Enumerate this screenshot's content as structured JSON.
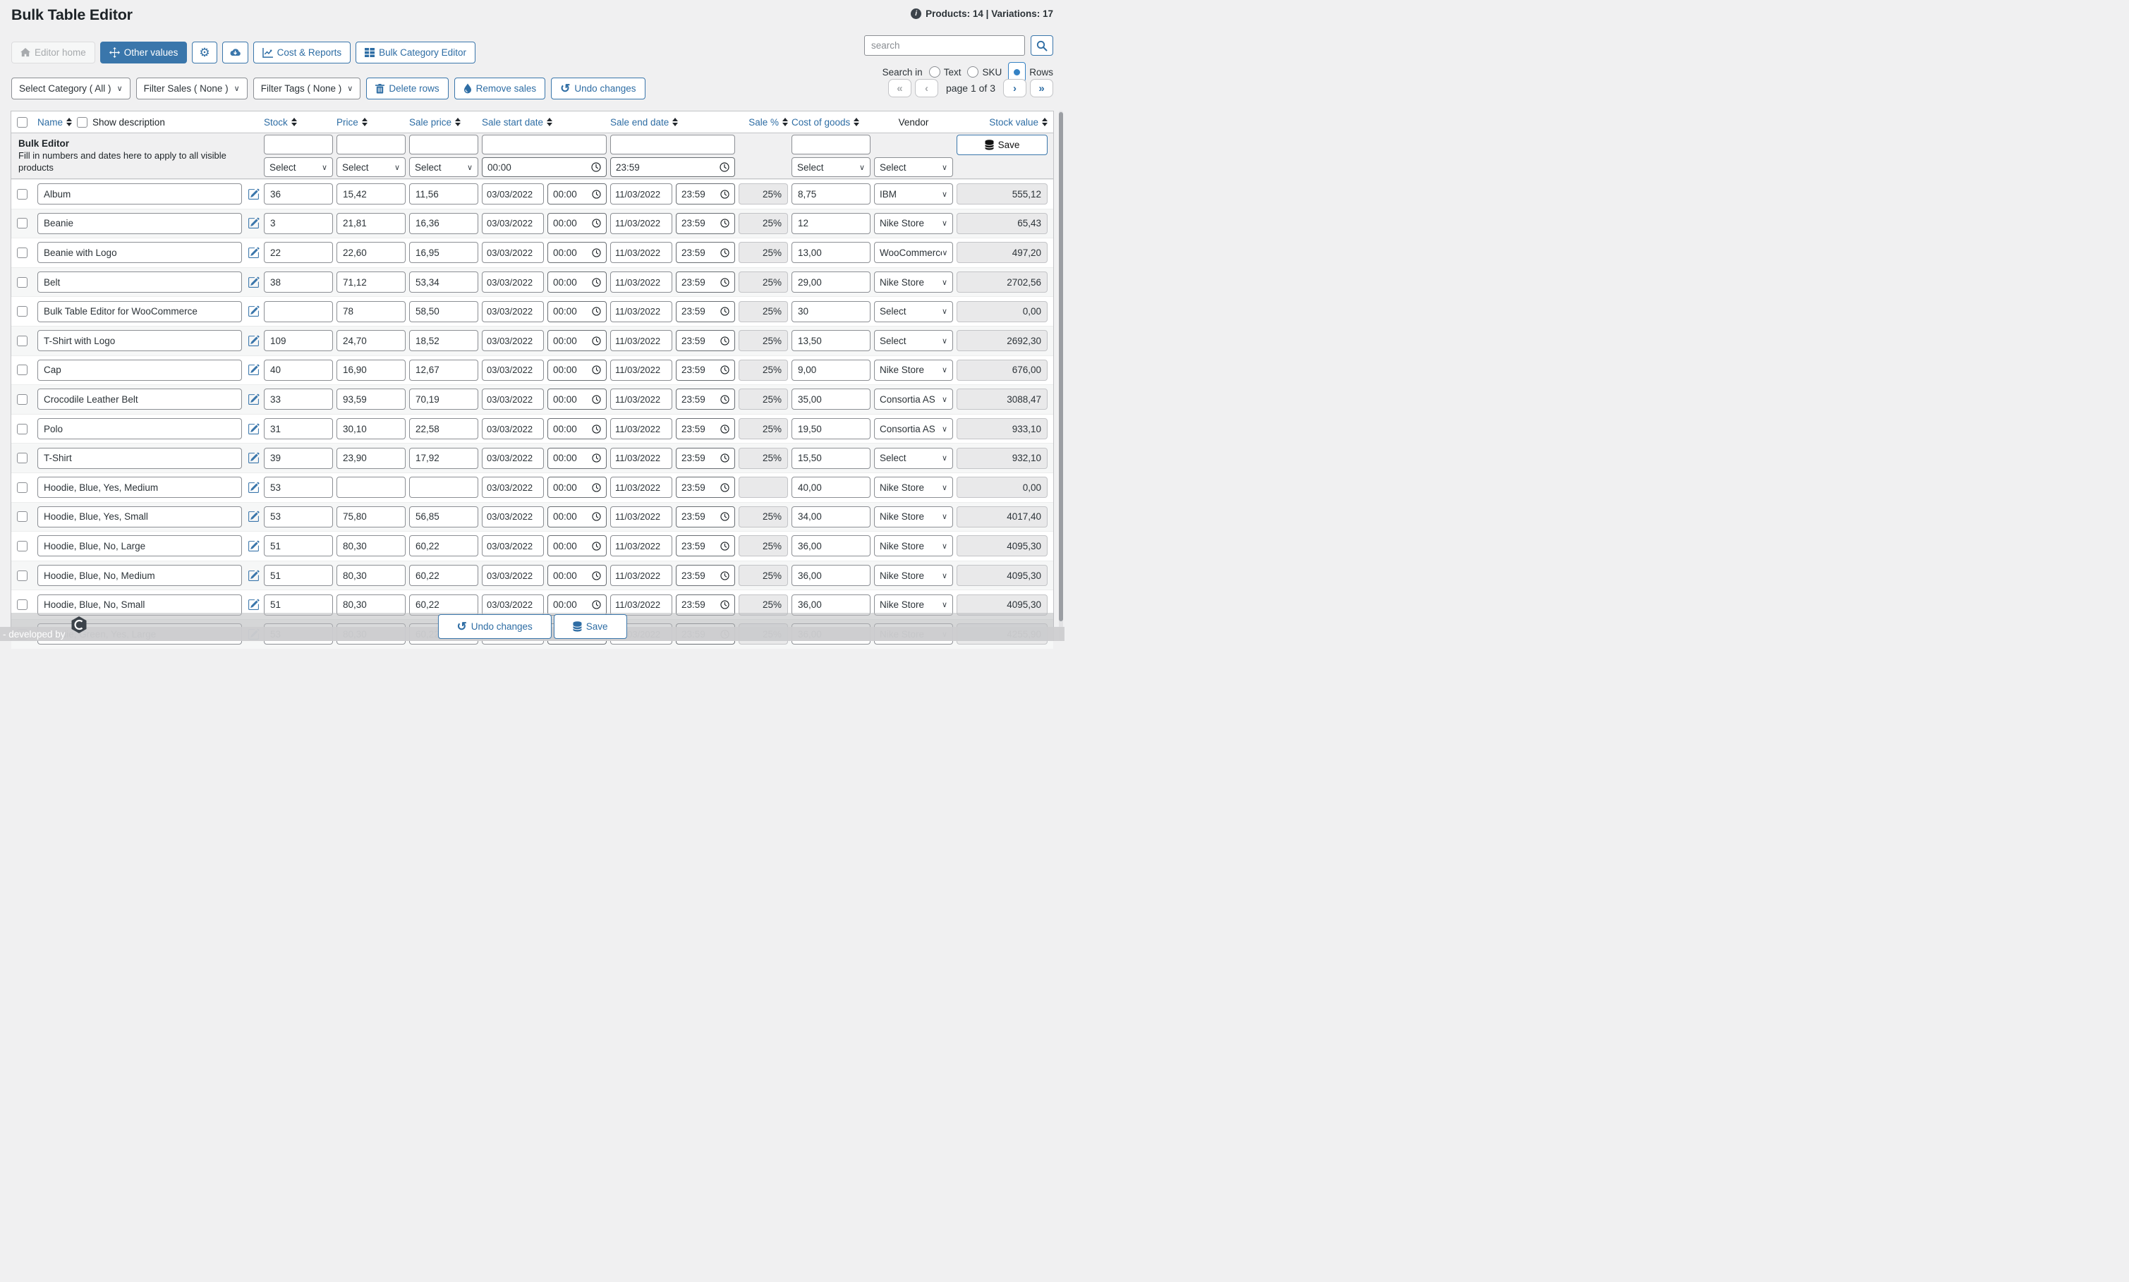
{
  "page": {
    "title": "Bulk Table Editor",
    "products_info": "Products: 14 | Variations: 17"
  },
  "toolbar": {
    "editor_home": "Editor home",
    "other_values": "Other values",
    "cost_reports": "Cost & Reports",
    "bulk_category_editor": "Bulk Category Editor"
  },
  "search": {
    "placeholder": "search",
    "search_in_label": "Search in",
    "options": [
      {
        "label": "Text",
        "selected": false
      },
      {
        "label": "SKU",
        "selected": false
      },
      {
        "label": "Rows",
        "selected": true
      }
    ]
  },
  "filters": {
    "category": "Select Category ( All )",
    "sales": "Filter Sales ( None )",
    "tags": "Filter Tags ( None )",
    "delete_rows": "Delete rows",
    "remove_sales": "Remove sales",
    "undo_changes": "Undo changes"
  },
  "pagination": {
    "label": "page 1 of 3"
  },
  "table": {
    "headers": {
      "name": "Name",
      "show_description": "Show description",
      "stock": "Stock",
      "price": "Price",
      "sale_price": "Sale price",
      "sale_start_date": "Sale start date",
      "sale_end_date": "Sale end date",
      "sale_pct": "Sale %",
      "cost_of_goods": "Cost of goods",
      "vendor": "Vendor",
      "stock_value": "Stock value"
    },
    "bulk": {
      "title": "Bulk Editor",
      "description": "Fill in numbers and dates here to apply to all visible products",
      "select_placeholder": "Select",
      "start_time": "00:00",
      "end_time": "23:59",
      "save_label": "Save"
    },
    "rows": [
      {
        "name": "Album",
        "stock": "36",
        "price": "15,42",
        "sale_price": "11,56",
        "start_date": "03/03/2022",
        "start_time": "00:00",
        "end_date": "11/03/2022",
        "end_time": "23:59",
        "sale_pct": "25%",
        "cost": "8,75",
        "vendor": "IBM",
        "stock_value": "555,12"
      },
      {
        "name": "Beanie",
        "stock": "3",
        "price": "21,81",
        "sale_price": "16,36",
        "start_date": "03/03/2022",
        "start_time": "00:00",
        "end_date": "11/03/2022",
        "end_time": "23:59",
        "sale_pct": "25%",
        "cost": "12",
        "vendor": "Nike Store",
        "stock_value": "65,43"
      },
      {
        "name": "Beanie with Logo",
        "stock": "22",
        "price": "22,60",
        "sale_price": "16,95",
        "start_date": "03/03/2022",
        "start_time": "00:00",
        "end_date": "11/03/2022",
        "end_time": "23:59",
        "sale_pct": "25%",
        "cost": "13,00",
        "vendor": "WooCommerce",
        "stock_value": "497,20"
      },
      {
        "name": "Belt",
        "stock": "38",
        "price": "71,12",
        "sale_price": "53,34",
        "start_date": "03/03/2022",
        "start_time": "00:00",
        "end_date": "11/03/2022",
        "end_time": "23:59",
        "sale_pct": "25%",
        "cost": "29,00",
        "vendor": "Nike Store",
        "stock_value": "2702,56"
      },
      {
        "name": "Bulk Table Editor for WooCommerce",
        "stock": "",
        "price": "78",
        "sale_price": "58,50",
        "start_date": "03/03/2022",
        "start_time": "00:00",
        "end_date": "11/03/2022",
        "end_time": "23:59",
        "sale_pct": "25%",
        "cost": "30",
        "vendor": "Select",
        "stock_value": "0,00"
      },
      {
        "name": "T-Shirt with Logo",
        "stock": "109",
        "price": "24,70",
        "sale_price": "18,52",
        "start_date": "03/03/2022",
        "start_time": "00:00",
        "end_date": "11/03/2022",
        "end_time": "23:59",
        "sale_pct": "25%",
        "cost": "13,50",
        "vendor": "Select",
        "stock_value": "2692,30"
      },
      {
        "name": "Cap",
        "stock": "40",
        "price": "16,90",
        "sale_price": "12,67",
        "start_date": "03/03/2022",
        "start_time": "00:00",
        "end_date": "11/03/2022",
        "end_time": "23:59",
        "sale_pct": "25%",
        "cost": "9,00",
        "vendor": "Nike Store",
        "stock_value": "676,00"
      },
      {
        "name": "Crocodile Leather Belt",
        "stock": "33",
        "price": "93,59",
        "sale_price": "70,19",
        "start_date": "03/03/2022",
        "start_time": "00:00",
        "end_date": "11/03/2022",
        "end_time": "23:59",
        "sale_pct": "25%",
        "cost": "35,00",
        "vendor": "Consortia AS",
        "stock_value": "3088,47"
      },
      {
        "name": "Polo",
        "stock": "31",
        "price": "30,10",
        "sale_price": "22,58",
        "start_date": "03/03/2022",
        "start_time": "00:00",
        "end_date": "11/03/2022",
        "end_time": "23:59",
        "sale_pct": "25%",
        "cost": "19,50",
        "vendor": "Consortia AS",
        "stock_value": "933,10"
      },
      {
        "name": "T-Shirt",
        "stock": "39",
        "price": "23,90",
        "sale_price": "17,92",
        "start_date": "03/03/2022",
        "start_time": "00:00",
        "end_date": "11/03/2022",
        "end_time": "23:59",
        "sale_pct": "25%",
        "cost": "15,50",
        "vendor": "Select",
        "stock_value": "932,10"
      },
      {
        "name": "Hoodie, Blue, Yes, Medium",
        "stock": "53",
        "price": "",
        "sale_price": "",
        "start_date": "03/03/2022",
        "start_time": "00:00",
        "end_date": "11/03/2022",
        "end_time": "23:59",
        "sale_pct": "",
        "cost": "40,00",
        "vendor": "Nike Store",
        "stock_value": "0,00"
      },
      {
        "name": "Hoodie, Blue, Yes, Small",
        "stock": "53",
        "price": "75,80",
        "sale_price": "56,85",
        "start_date": "03/03/2022",
        "start_time": "00:00",
        "end_date": "11/03/2022",
        "end_time": "23:59",
        "sale_pct": "25%",
        "cost": "34,00",
        "vendor": "Nike Store",
        "stock_value": "4017,40"
      },
      {
        "name": "Hoodie, Blue, No, Large",
        "stock": "51",
        "price": "80,30",
        "sale_price": "60,22",
        "start_date": "03/03/2022",
        "start_time": "00:00",
        "end_date": "11/03/2022",
        "end_time": "23:59",
        "sale_pct": "25%",
        "cost": "36,00",
        "vendor": "Nike Store",
        "stock_value": "4095,30"
      },
      {
        "name": "Hoodie, Blue, No, Medium",
        "stock": "51",
        "price": "80,30",
        "sale_price": "60,22",
        "start_date": "03/03/2022",
        "start_time": "00:00",
        "end_date": "11/03/2022",
        "end_time": "23:59",
        "sale_pct": "25%",
        "cost": "36,00",
        "vendor": "Nike Store",
        "stock_value": "4095,30"
      },
      {
        "name": "Hoodie, Blue, No, Small",
        "stock": "51",
        "price": "80,30",
        "sale_price": "60,22",
        "start_date": "03/03/2022",
        "start_time": "00:00",
        "end_date": "11/03/2022",
        "end_time": "23:59",
        "sale_pct": "25%",
        "cost": "36,00",
        "vendor": "Nike Store",
        "stock_value": "4095,30"
      },
      {
        "name": "Hoodie, Green, Yes, Large",
        "stock": "53",
        "price": "80,30",
        "sale_price": "60,22",
        "start_date": "03/03/2022",
        "start_time": "00:00",
        "end_date": "11/03/2022",
        "end_time": "23:59",
        "sale_pct": "25%",
        "cost": "36,00",
        "vendor": "Nike Store",
        "stock_value": "4255,90"
      }
    ]
  },
  "footer": {
    "developed_by": "- developed by",
    "undo_changes": "Undo changes",
    "save": "Save"
  },
  "icons": {
    "gear": "⚙",
    "undo": "↺",
    "first": "«",
    "prev": "‹",
    "next": "›",
    "last": "»",
    "select_chevron": "∨"
  },
  "colors": {
    "accent_blue": "#3a76ab",
    "link_blue": "#2e6da4",
    "page_bg": "#f0f0f1",
    "table_border": "#c3c4c7"
  }
}
